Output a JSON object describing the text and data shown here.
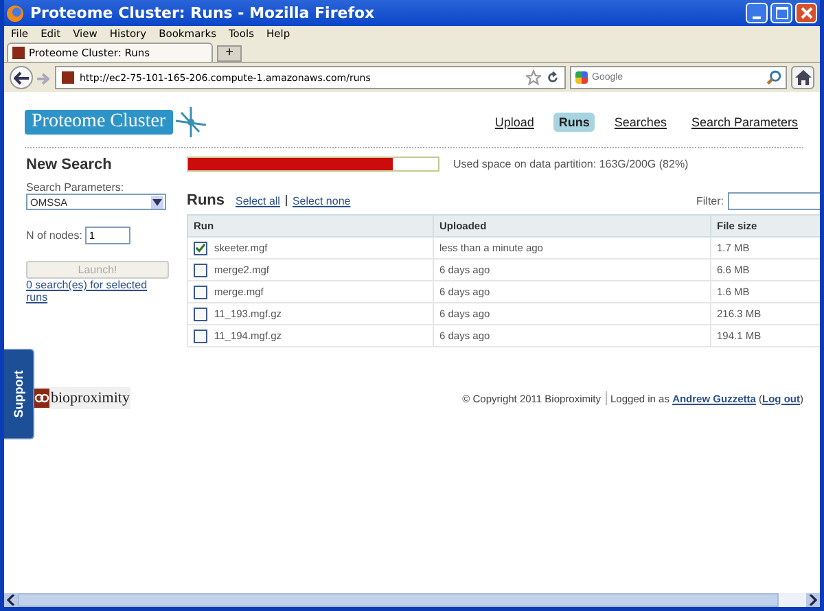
{
  "window": {
    "title": "Proteome Cluster: Runs - Mozilla Firefox"
  },
  "menu": [
    "File",
    "Edit",
    "View",
    "History",
    "Bookmarks",
    "Tools",
    "Help"
  ],
  "tab": {
    "title": "Proteome Cluster: Runs",
    "new_tab": "+"
  },
  "address_bar": {
    "url": "http://ec2-75-101-165-206.compute-1.amazonaws.com/runs"
  },
  "search": {
    "placeholder": "Google"
  },
  "header": {
    "logo": "Proteome Cluster",
    "nav": [
      {
        "label": "Upload",
        "selected": false
      },
      {
        "label": "Runs",
        "selected": true
      },
      {
        "label": "Searches",
        "selected": false
      },
      {
        "label": "Search Parameters",
        "selected": false
      }
    ]
  },
  "sidebar": {
    "heading": "New Search",
    "params_label": "Search Parameters:",
    "params_value": "OMSSA",
    "nodes_label": "N of nodes:",
    "nodes_value": "1",
    "launch": {
      "label": "Launch!",
      "disabled": true
    },
    "link": "0 search(es) for selected runs"
  },
  "disk": {
    "level": 0.82,
    "text": "Used space on data partition: 163G/200G (82%)"
  },
  "runs": {
    "heading": "Runs",
    "select_all": "Select all",
    "select_none": "Select none",
    "filter_label": "Filter:",
    "columns": [
      "Run",
      "Uploaded",
      "File size"
    ],
    "rows": [
      {
        "name": "skeeter.mgf",
        "uploaded": "less than a minute ago",
        "size": "1.7 MB",
        "checked": true
      },
      {
        "name": "merge2.mgf",
        "uploaded": "6 days ago",
        "size": "6.6 MB",
        "checked": false
      },
      {
        "name": "merge.mgf",
        "uploaded": "6 days ago",
        "size": "1.6 MB",
        "checked": false
      },
      {
        "name": "11_193.mgf.gz",
        "uploaded": "6 days ago",
        "size": "216.3 MB",
        "checked": false
      },
      {
        "name": "11_194.mgf.gz",
        "uploaded": "6 days ago",
        "size": "194.1 MB",
        "checked": false
      }
    ]
  },
  "footer": {
    "brand": "bioproximity",
    "copyright": "© Copyright 2011 Bioproximity",
    "logged_in": "Logged in as",
    "user": "Andrew Guzzetta",
    "logout": "Log out",
    "paren_open": "(",
    "paren_close": ")"
  },
  "support": "Support"
}
